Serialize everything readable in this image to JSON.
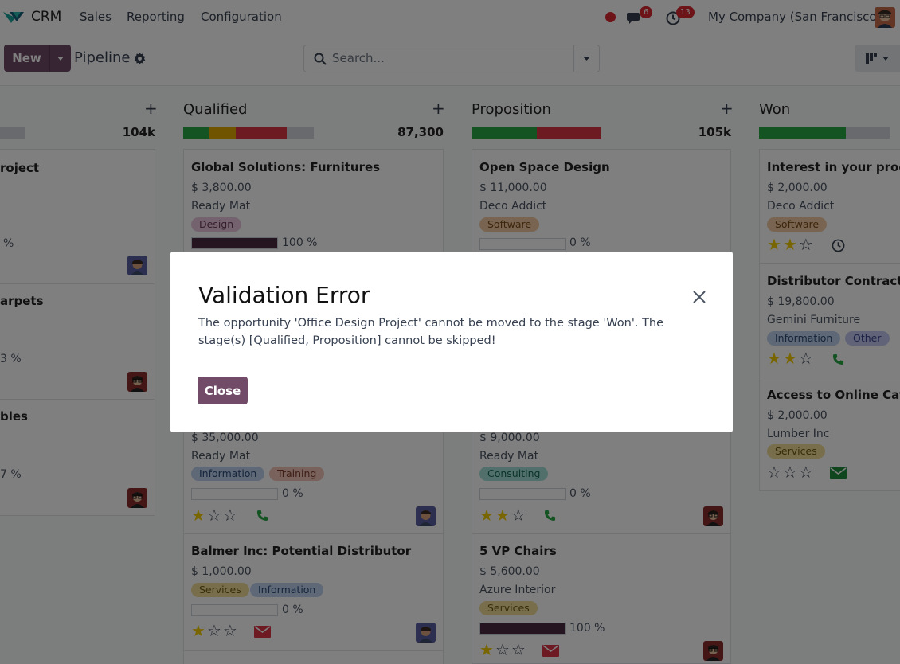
{
  "navbar": {
    "app_name": "CRM",
    "menu": [
      "Sales",
      "Reporting",
      "Configuration"
    ],
    "messages_count": "6",
    "activities_count": "13",
    "company": "My Company (San Francisco)"
  },
  "control": {
    "new_label": "New",
    "breadcrumb": "Pipeline",
    "search_placeholder": "Search..."
  },
  "columns": [
    {
      "name": "",
      "total": "104k",
      "cards": [
        {
          "title": "roject",
          "progress_text": "%"
        },
        {
          "title": "arpets",
          "progress_text": "3 %"
        },
        {
          "title": "bles",
          "progress_text": "7 %"
        }
      ]
    },
    {
      "name": "Qualified",
      "total": "87,300",
      "cards": [
        {
          "title": "Global Solutions: Furnitures",
          "amount": "$ 3,800.00",
          "partner": "Ready Mat",
          "tags": [
            "Design"
          ],
          "progress": 100,
          "progress_text": "100 %"
        },
        {
          "amount": "$ 35,000.00",
          "partner": "Ready Mat",
          "tags": [
            "Information",
            "Training"
          ],
          "progress": 0,
          "progress_text": "0 %",
          "stars": 1
        },
        {
          "title": "Balmer Inc: Potential Distributor",
          "amount": "$ 1,000.00",
          "tags": [
            "Services",
            "Information"
          ],
          "progress": 0,
          "progress_text": "0 %",
          "stars": 1
        }
      ]
    },
    {
      "name": "Proposition",
      "total": "105k",
      "cards": [
        {
          "title": "Open Space Design",
          "amount": "$ 11,000.00",
          "partner": "Deco Addict",
          "tags": [
            "Software"
          ],
          "progress": 0,
          "progress_text": "0 %"
        },
        {
          "amount": "$ 9,000.00",
          "partner": "Ready Mat",
          "tags": [
            "Consulting"
          ],
          "progress": 0,
          "progress_text": "0 %",
          "stars": 2
        },
        {
          "title": "5 VP Chairs",
          "amount": "$ 5,600.00",
          "partner": "Azure Interior",
          "tags": [
            "Services"
          ],
          "progress": 100,
          "progress_text": "100 %",
          "stars": 1
        }
      ]
    },
    {
      "name": "Won",
      "cards": [
        {
          "title": "Interest in your produ",
          "amount": "$ 2,000.00",
          "partner": "Deco Addict",
          "tags": [
            "Software"
          ],
          "stars": 2
        },
        {
          "title": "Distributor Contract",
          "amount": "$ 19,800.00",
          "partner": "Gemini Furniture",
          "tags": [
            "Information",
            "Other"
          ],
          "stars": 2
        },
        {
          "title": "Access to Online Cata",
          "amount": "$ 2,000.00",
          "partner": "Lumber Inc",
          "tags": [
            "Services"
          ],
          "stars": 0
        }
      ]
    }
  ],
  "modal": {
    "title": "Validation Error",
    "message": "The opportunity 'Office Design Project' cannot be moved to the stage 'Won'. The stage(s) [Qualified, Proposition] cannot be skipped!",
    "close_label": "Close"
  },
  "colors": {
    "brand": "#714b67",
    "bar_green": "#28a745",
    "bar_orange": "#e0a800",
    "bar_red": "#dc3545",
    "bar_grey": "#d1d5db"
  }
}
